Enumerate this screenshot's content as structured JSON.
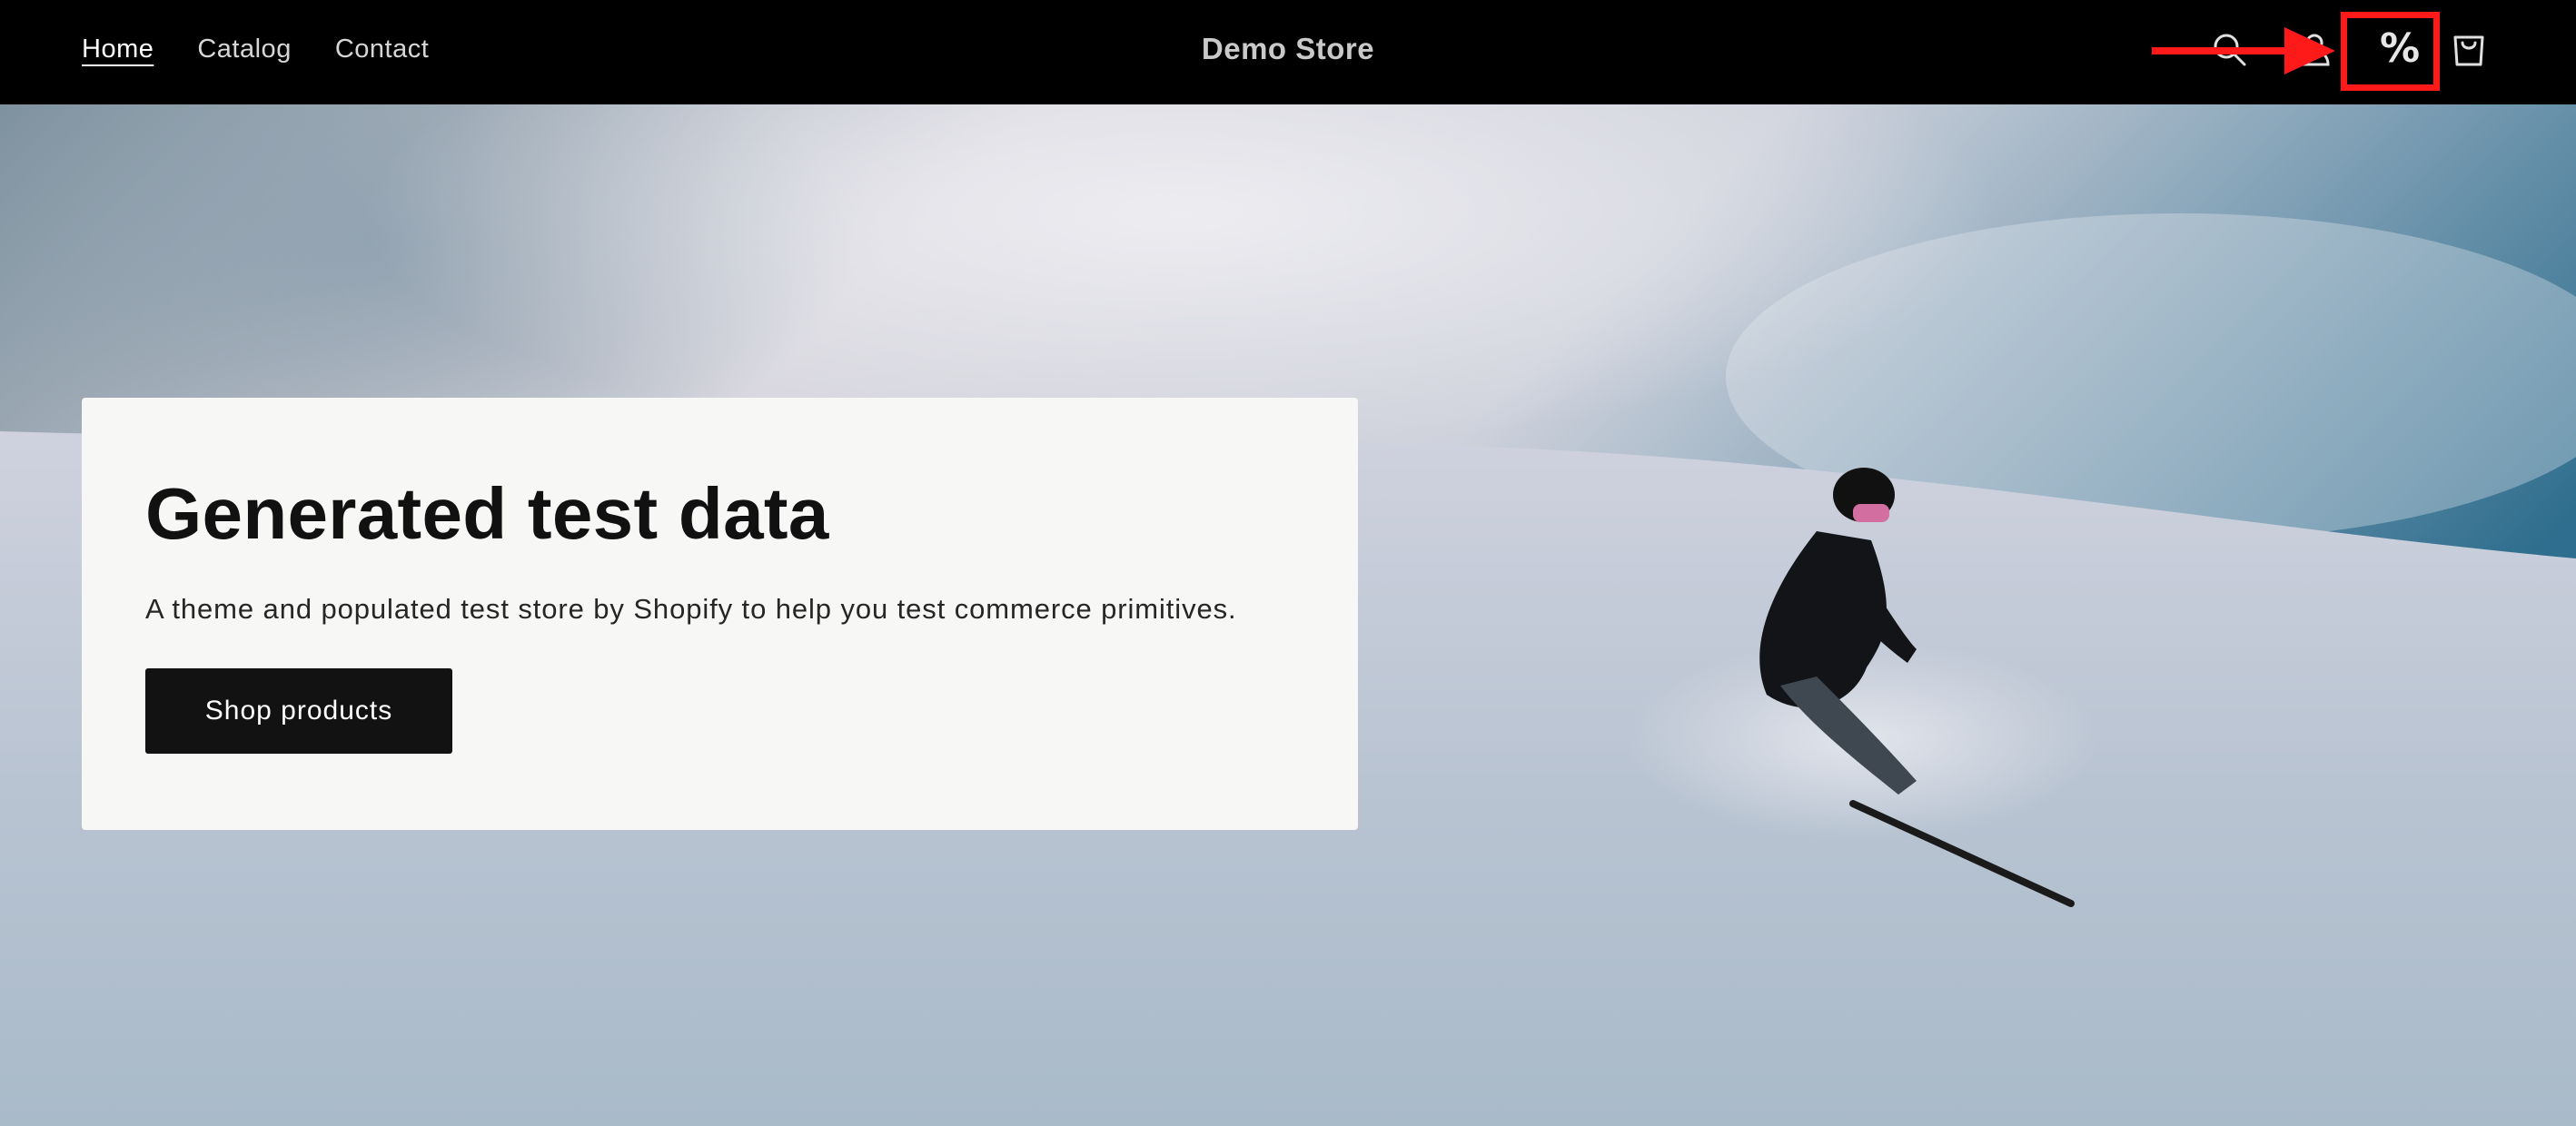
{
  "header": {
    "nav": [
      {
        "label": "Home",
        "active": true
      },
      {
        "label": "Catalog",
        "active": false
      },
      {
        "label": "Contact",
        "active": false
      }
    ],
    "brand": "Demo Store",
    "icons": {
      "search": "search-icon",
      "account": "account-icon",
      "discount": "%",
      "cart": "cart-icon"
    }
  },
  "annotation": {
    "color": "#ff1a1a",
    "target": "discount-icon"
  },
  "hero": {
    "title": "Generated test data",
    "subtitle": "A theme and populated test store by Shopify to help you test commerce primitives.",
    "cta_label": "Shop products"
  },
  "colors": {
    "header_bg": "#000000",
    "card_bg": "#f7f7f5",
    "button_bg": "#121212",
    "text_dark": "#111111"
  }
}
